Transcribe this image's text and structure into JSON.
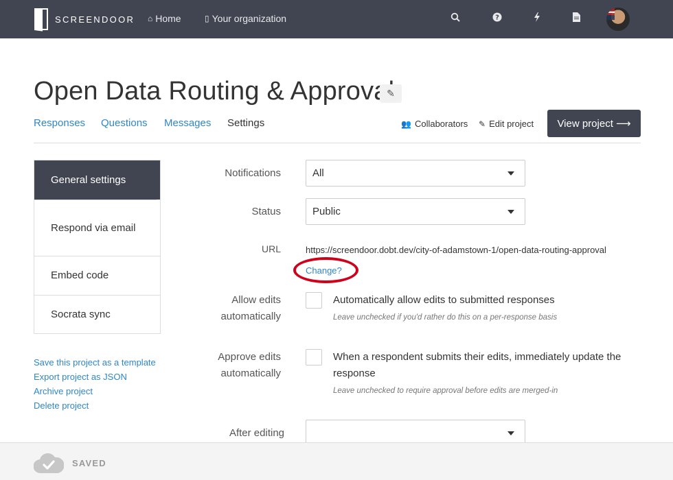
{
  "topbar": {
    "brand": "SCREENDOOR",
    "nav": [
      {
        "label": "Home",
        "icon": "home-icon"
      },
      {
        "label": "Your organization",
        "icon": "building-icon"
      }
    ],
    "icons": [
      "search-icon",
      "help-icon",
      "bolt-icon",
      "document-icon"
    ],
    "avatar": "user-avatar"
  },
  "page": {
    "title": "Open Data Routing & Approval",
    "tabs": [
      {
        "label": "Responses",
        "active": false
      },
      {
        "label": "Questions",
        "active": false
      },
      {
        "label": "Messages",
        "active": false
      },
      {
        "label": "Settings",
        "active": true
      }
    ],
    "actions": {
      "collaborators": "Collaborators",
      "edit_project": "Edit project",
      "view_project": "View project ⟶"
    }
  },
  "sidebar": {
    "items": [
      {
        "label": "General settings",
        "active": true
      },
      {
        "label": "Respond via email",
        "active": false
      },
      {
        "label": "Embed code",
        "active": false
      },
      {
        "label": "Socrata sync",
        "active": false
      }
    ],
    "links": [
      "Save this project as a template",
      "Export project as JSON",
      "Archive project",
      "Delete project"
    ]
  },
  "form": {
    "notifications": {
      "label": "Notifications",
      "value": "All"
    },
    "status": {
      "label": "Status",
      "value": "Public"
    },
    "url": {
      "label": "URL",
      "value": "https://screendoor.dobt.dev/city-of-adamstown-1/open-data-routing-approval",
      "change": "Change?"
    },
    "allow_edits": {
      "label_line1": "Allow edits",
      "label_line2": "automatically",
      "text": "Automatically allow edits to submitted responses",
      "hint": "Leave unchecked if you'd rather do this on a per-response basis",
      "checked": false
    },
    "approve_edits": {
      "label_line1": "Approve edits",
      "label_line2": "automatically",
      "text": "When a respondent submits their edits, immediately update the response",
      "hint": "Leave unchecked to require approval before edits are merged-in",
      "checked": false
    },
    "after_editing": {
      "label": "After editing",
      "value": ""
    }
  },
  "footer": {
    "status": "SAVED"
  },
  "colors": {
    "topbar": "#414551",
    "link": "#2f86c6",
    "highlight": "#d0021b"
  }
}
